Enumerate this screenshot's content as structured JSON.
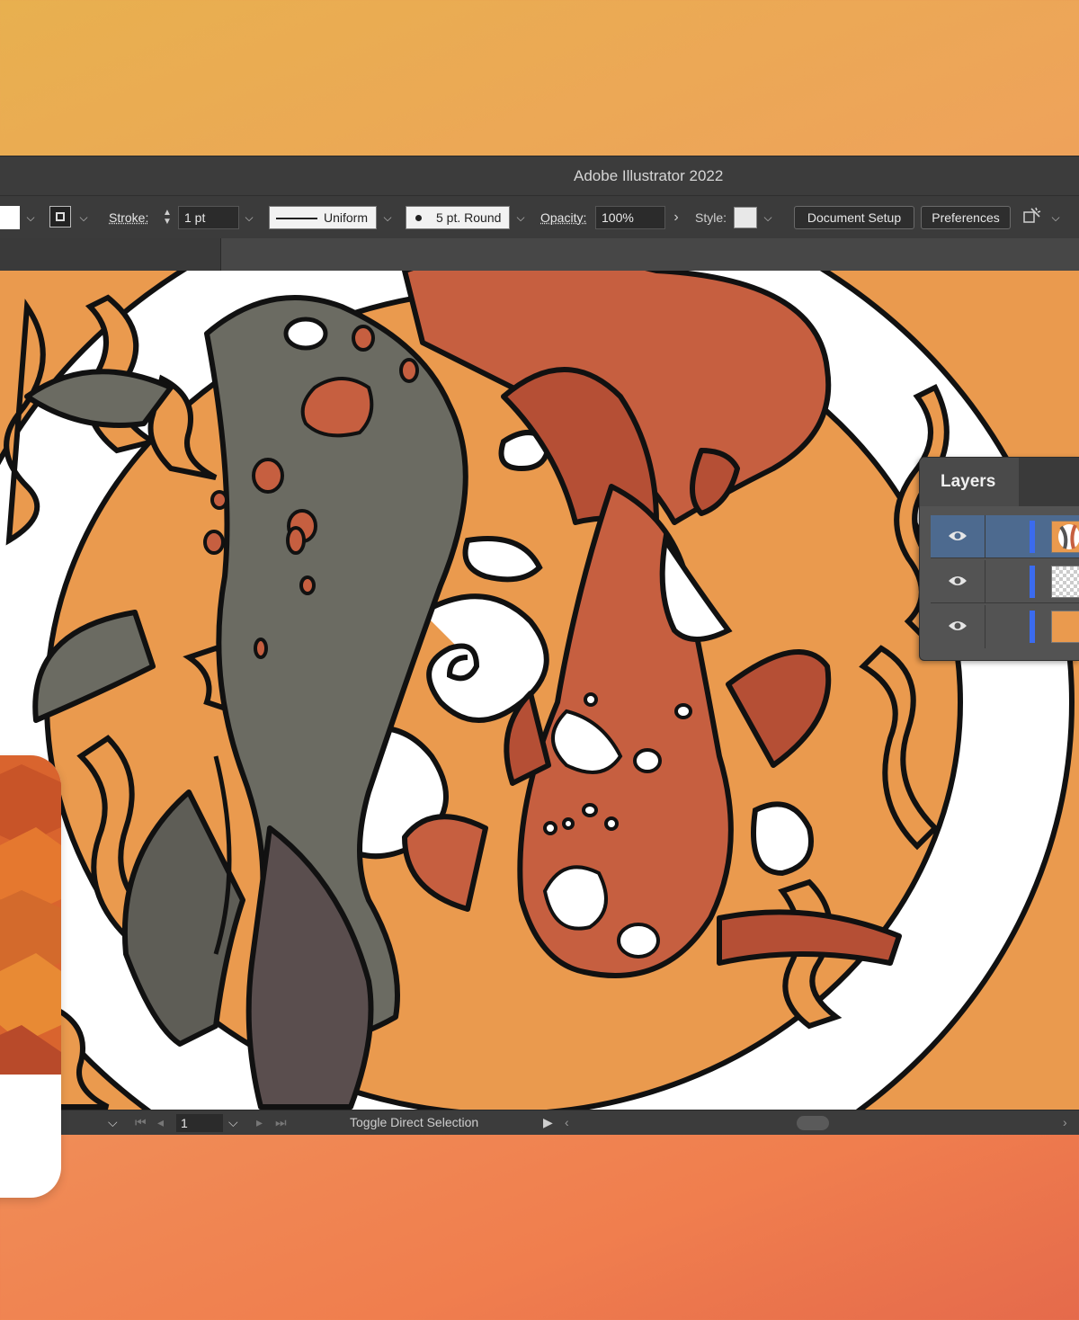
{
  "window": {
    "title": "Adobe Illustrator 2022"
  },
  "control_bar": {
    "stroke_label": "Stroke:",
    "stroke_weight": "1 pt",
    "profile_label": "Uniform",
    "brush_label": "5 pt. Round",
    "opacity_label": "Opacity:",
    "opacity_value": "100%",
    "style_label": "Style:",
    "document_setup_label": "Document Setup",
    "preferences_label": "Preferences"
  },
  "status_bar": {
    "artboard_number": "1",
    "status_text": "Toggle Direct Selection"
  },
  "layers_panel": {
    "title": "Layers",
    "layers": [
      {
        "selected": true,
        "thumb": "artwork"
      },
      {
        "selected": false,
        "thumb": "transparent"
      },
      {
        "selected": false,
        "thumb": "orange"
      }
    ]
  },
  "colors": {
    "canvas_background": "#ea9a4e",
    "koi_dark": "#6b6b62",
    "koi_red": "#c65f40",
    "accent_blue": "#3b6bef"
  },
  "icons": [
    "chevron-down-icon",
    "stroke-box-icon",
    "stepper-icon",
    "arrow-right-icon",
    "eye-icon",
    "magic-wand-icon",
    "first-page-icon",
    "prev-page-icon",
    "next-page-icon",
    "last-page-icon",
    "play-icon",
    "chevron-left-icon",
    "chevron-right-icon"
  ]
}
